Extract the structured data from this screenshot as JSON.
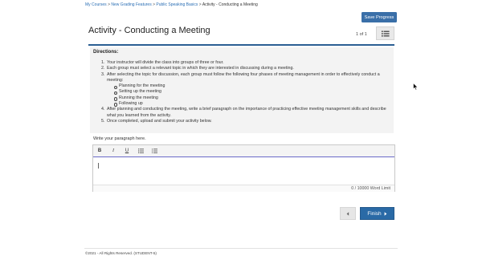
{
  "breadcrumb": {
    "items": [
      "My Courses",
      "New Grading Features",
      "Public Speaking Basics"
    ],
    "current": "Activity - Conducting a Meeting",
    "separator": ">"
  },
  "header": {
    "save_label": "Save Progress",
    "title": "Activity - Conducting a Meeting",
    "page_count": "1 of 1",
    "list_icon": "list-icon"
  },
  "directions": {
    "title": "Directions:",
    "steps": [
      {
        "num": "1.",
        "text": "Your instructor will divide the class into groups of three or four."
      },
      {
        "num": "2.",
        "text": "Each group must select a relevant topic in which they are interested in discussing during a meeting."
      },
      {
        "num": "3.",
        "text": "After selecting the topic for discussion, each group must follow the following four phases of meeting management in order to effectively conduct a meeting:"
      },
      {
        "num": "4.",
        "text": "After planning and conducting the meeting, write a brief paragraph on the importance of practicing effective meeting management skills and describe what you learned from the activity."
      },
      {
        "num": "5.",
        "text": "Once completed, upload and submit your activity below."
      }
    ],
    "phases": [
      "Planning for the meeting",
      "Setting up the meeting",
      "Running the meeting",
      "Following up"
    ]
  },
  "editor": {
    "prompt": "Write your paragraph here.",
    "toolbar": {
      "bold": "B",
      "italic": "I",
      "underline": "U"
    },
    "word_limit": "0 / 10000 Word Limit"
  },
  "nav": {
    "prev_icon": "chevron-left-icon",
    "finish_label": "Finish",
    "finish_icon": "caret-right-icon"
  },
  "footer": {
    "text": "©2021 - All Rights Reserved. (STUDENT-5)"
  },
  "colors": {
    "accent": "#2b5f93",
    "button": "#3a6fa8",
    "link": "#2b6fb5"
  }
}
